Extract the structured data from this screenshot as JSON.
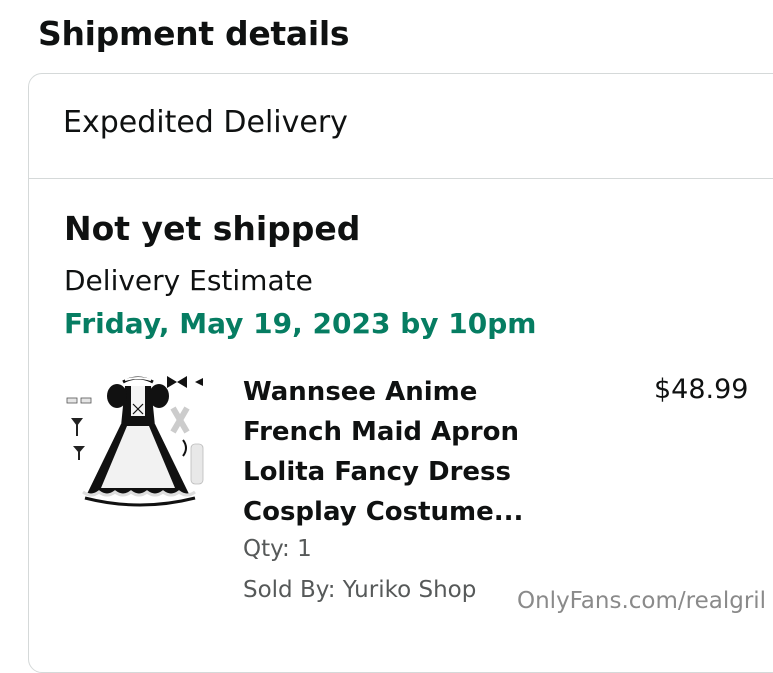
{
  "page_title": "Shipment details",
  "delivery_type": "Expedited Delivery",
  "shipment": {
    "status": "Not yet shipped",
    "estimate_label": "Delivery Estimate",
    "estimate_date": "Friday, May 19, 2023 by 10pm"
  },
  "item": {
    "title_lines": [
      "Wannsee Anime",
      "French Maid Apron",
      "Lolita Fancy Dress",
      "Cosplay Costume..."
    ],
    "price": "$48.99",
    "qty": "Qty: 1",
    "sold_by": "Sold By: Yuriko Shop",
    "image_icon": "maid-costume-product-image"
  },
  "watermark": "OnlyFans.com/realgril",
  "colors": {
    "estimate_date": "#067d62",
    "secondary_text": "#565959",
    "border": "#d5d9d9"
  }
}
